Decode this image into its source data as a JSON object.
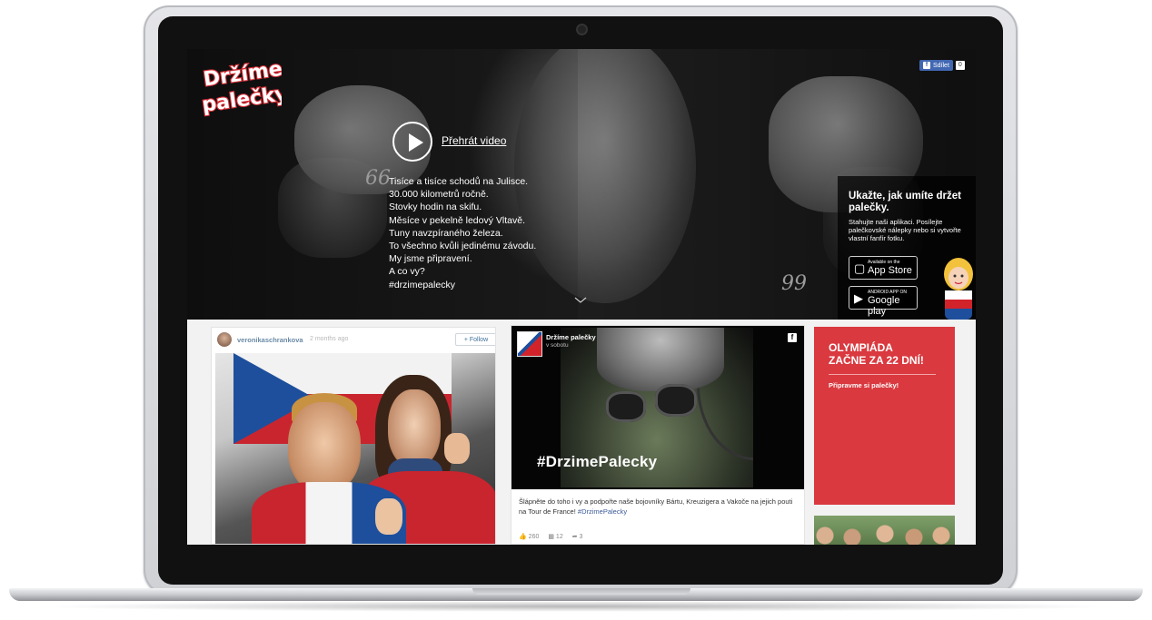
{
  "header": {
    "logo_text": "Držíme palečky",
    "share": {
      "label": "Sdílet",
      "count": "0"
    },
    "video": {
      "label": "Přehrát video"
    },
    "manifesto": [
      "Tisíce a tisíce schodů na Julisce.",
      "30.000 kilometrů ročně.",
      "Stovky hodin na skifu.",
      "Měsíce v pekelně ledový Vltavě.",
      "Tuny navzpíraného železa.",
      "To všechno kvůli jedinému závodu.",
      "My jsme připravení.",
      "A co vy?",
      "#drzimepalecky"
    ],
    "quote_open": "66",
    "quote_close": "99"
  },
  "promo": {
    "title": "Ukažte, jak umíte držet palečky.",
    "text": "Stahujte naši aplikaci. Posílejte palečkovské nálepky nebo si vytvořte vlastní fanfír fotku.",
    "app_store": {
      "small": "Available on the",
      "big": "App Store"
    },
    "google_play": {
      "small": "ANDROID APP ON",
      "big": "Google play"
    }
  },
  "instagram_post": {
    "username": "veronikaschrankova",
    "time_ago": "2 months ago",
    "follow_label": "+ Follow"
  },
  "facebook_post": {
    "page_name": "Držíme palečky",
    "subtitle": "v sobotu",
    "hashtag_overlay": "#DrzimePalecky",
    "text": "Šlápněte do toho i vy a podpořte naše bojovníky Bártu, Kreuzigera a Vakoče na jejich pouti na Tour de France!",
    "text_hashtag": "#DrzimePalecky",
    "likes": "260",
    "comments": "12",
    "shares": "3"
  },
  "countdown": {
    "title_line1": "OLYMPIÁDA",
    "title_line2": "ZAČNE ZA 22 DNÍ!",
    "subtitle": "Připravme si palečky!"
  },
  "colors": {
    "accent_red": "#d9393f",
    "facebook_blue": "#4267b2",
    "instagram_blue": "#3f729b"
  }
}
